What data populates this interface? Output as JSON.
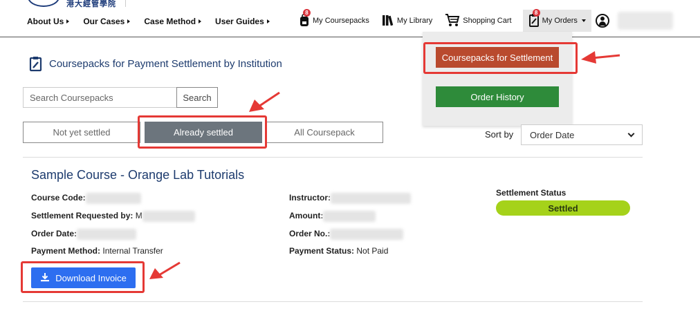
{
  "header": {
    "nav": [
      {
        "label": "About Us"
      },
      {
        "label": "Our Cases"
      },
      {
        "label": "Case Method"
      },
      {
        "label": "User Guides"
      }
    ],
    "coursepacks": {
      "label": "My Coursepacks",
      "badge": "8"
    },
    "library": {
      "label": "My Library"
    },
    "cart": {
      "label": "Shopping Cart"
    },
    "orders": {
      "label": "My Orders",
      "badge": "8"
    }
  },
  "orders_menu": {
    "settlement_label": "Coursepacks for Settlement",
    "history_label": "Order History"
  },
  "page": {
    "title": "Coursepacks for Payment Settlement by Institution"
  },
  "search": {
    "placeholder": "Search Coursepacks",
    "button_label": "Search"
  },
  "tabs": [
    {
      "label": "Not yet settled",
      "active": false
    },
    {
      "label": "Already settled",
      "active": true
    },
    {
      "label": "All Coursepack",
      "active": false
    }
  ],
  "sort": {
    "label": "Sort by",
    "selected": "Order Date"
  },
  "course": {
    "title": "Sample Course - Orange Lab Tutorials",
    "code_label": "Course Code:",
    "requested_label": "Settlement Requested by:",
    "requested_value": "M",
    "order_date_label": "Order Date:",
    "payment_method_label": "Payment Method:",
    "payment_method_value": "Internal Transfer",
    "instructor_label": "Instructor:",
    "amount_label": "Amount:",
    "order_no_label": "Order No.:",
    "payment_status_label": "Payment Status:",
    "payment_status_value": "Not Paid",
    "settlement_status_label": "Settlement Status",
    "settlement_status_value": "Settled",
    "download_label": "Download Invoice"
  },
  "colors": {
    "settle_button": "#b94a2e",
    "history_button": "#2e8b3a",
    "active_tab": "#6c757d",
    "status_pill": "#a5d21a",
    "download_button": "#2d6ef0",
    "annotation": "#e53935"
  }
}
